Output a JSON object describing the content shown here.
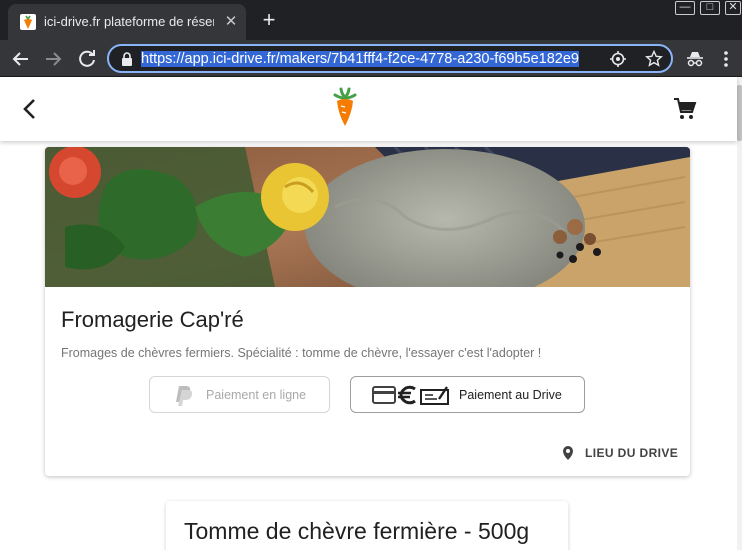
{
  "browser": {
    "tab_title": "ici-drive.fr plateforme de réservation",
    "tab_close": "✕",
    "new_tab": "+",
    "url": "https://app.ici-drive.fr/makers/7b41fff4-f2ce-4778-a230-f69b5e182e9",
    "win_minimize": "—",
    "win_maximize": "□",
    "win_close": "✕"
  },
  "maker": {
    "name": "Fromagerie Cap'ré",
    "description": "Fromages de chèvres fermiers. Spécialité : tomme de chèvre, l'essayer c'est l'adopter !",
    "pay_online_label": "Paiement en ligne",
    "pay_drive_label": "Paiement au Drive",
    "drive_location_label": "LIEU DU DRIVE"
  },
  "product": {
    "title": "Tomme de chèvre fermière - 500g"
  },
  "icons": [
    "back-arrow-icon",
    "carrot-logo",
    "cart-icon",
    "paypal-icon",
    "card-icon",
    "euro-icon",
    "cheque-icon",
    "location-pin-icon"
  ],
  "colors": {
    "brand_orange": "#f57c00",
    "brand_green": "#43a047",
    "chrome_dark": "#202124",
    "selection_blue": "#3367d6"
  }
}
